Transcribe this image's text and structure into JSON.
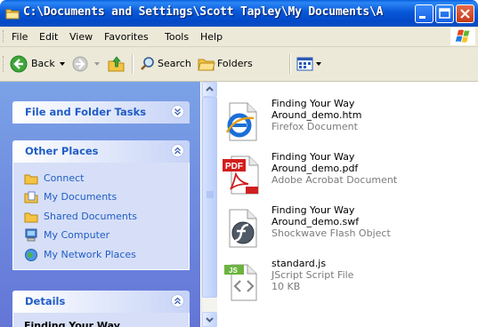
{
  "window": {
    "title": "C:\\Documents and Settings\\Scott Tapley\\My Documents\\Adob...",
    "buttons": {
      "minimize": "minimize-icon",
      "maximize": "maximize-icon",
      "close": "close-icon"
    }
  },
  "menu": {
    "items": [
      "File",
      "Edit",
      "View",
      "Favorites",
      "Tools",
      "Help"
    ]
  },
  "toolbar": {
    "back_label": "Back",
    "search_label": "Search",
    "folders_label": "Folders"
  },
  "task_pane": {
    "file_folder_tasks": {
      "title": "File and Folder Tasks"
    },
    "other_places": {
      "title": "Other Places",
      "items": [
        {
          "label": "Connect",
          "icon": "folder-icon"
        },
        {
          "label": "My Documents",
          "icon": "my-documents-icon"
        },
        {
          "label": "Shared Documents",
          "icon": "folder-icon"
        },
        {
          "label": "My Computer",
          "icon": "my-computer-icon"
        },
        {
          "label": "My Network Places",
          "icon": "network-places-icon"
        }
      ]
    },
    "details": {
      "title": "Details",
      "name_preview": "Finding Your Way"
    }
  },
  "files": [
    {
      "name_line1": "Finding Your Way",
      "name_line2": "Around_demo.htm",
      "type": "Firefox Document",
      "size": "",
      "icon": "ie-document-icon"
    },
    {
      "name_line1": "Finding Your Way",
      "name_line2": "Around_demo.pdf",
      "type": "Adobe Acrobat Document",
      "size": "",
      "icon": "pdf-icon"
    },
    {
      "name_line1": "Finding Your Way",
      "name_line2": "Around_demo.swf",
      "type": "Shockwave Flash Object",
      "size": "",
      "icon": "flash-icon"
    },
    {
      "name_line1": "standard.js",
      "name_line2": "",
      "type": "JScript Script File",
      "size": "10 KB",
      "icon": "jscript-icon"
    }
  ],
  "colors": {
    "title_bar": "#0858d8",
    "task_pane": "#6f8ee0",
    "link_text": "#215dc6",
    "secondary_text": "#7b7b7b"
  }
}
